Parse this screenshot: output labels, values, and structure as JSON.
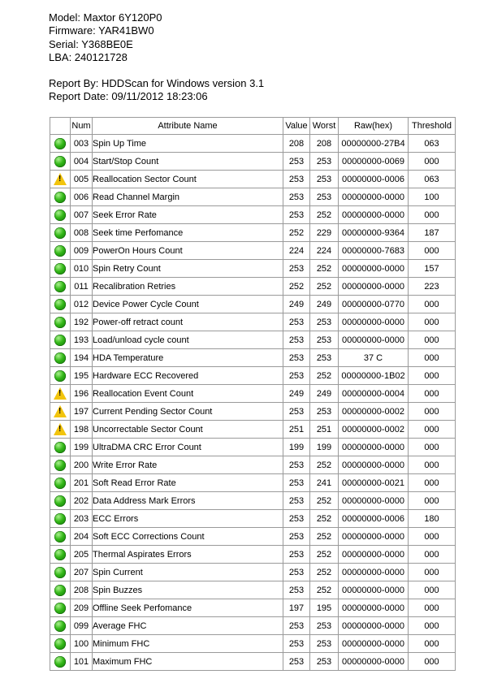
{
  "report": {
    "model": "Model: Maxtor 6Y120P0",
    "firmware": "Firmware: YAR41BW0",
    "serial": "Serial: Y368BE0E",
    "lba": "LBA: 240121728",
    "report_by": "Report By: HDDScan for Windows version 3.1",
    "report_date": "Report Date: 09/11/2012 18:23:06"
  },
  "table": {
    "headers": {
      "status": "",
      "num": "Num",
      "name": "Attribute Name",
      "value": "Value",
      "worst": "Worst",
      "raw": "Raw(hex)",
      "threshold": "Threshold"
    },
    "status_colors": {
      "ok": "#2fb514",
      "warn": "#f2c40c"
    },
    "rows": [
      {
        "status": "ok",
        "num": "003",
        "name": "Spin Up Time",
        "value": "208",
        "worst": "208",
        "raw": "00000000-27B4",
        "threshold": "063"
      },
      {
        "status": "ok",
        "num": "004",
        "name": "Start/Stop Count",
        "value": "253",
        "worst": "253",
        "raw": "00000000-0069",
        "threshold": "000"
      },
      {
        "status": "warn",
        "num": "005",
        "name": "Reallocation Sector Count",
        "value": "253",
        "worst": "253",
        "raw": "00000000-0006",
        "threshold": "063"
      },
      {
        "status": "ok",
        "num": "006",
        "name": "Read Channel Margin",
        "value": "253",
        "worst": "253",
        "raw": "00000000-0000",
        "threshold": "100"
      },
      {
        "status": "ok",
        "num": "007",
        "name": "Seek Error Rate",
        "value": "253",
        "worst": "252",
        "raw": "00000000-0000",
        "threshold": "000"
      },
      {
        "status": "ok",
        "num": "008",
        "name": "Seek time Perfomance",
        "value": "252",
        "worst": "229",
        "raw": "00000000-9364",
        "threshold": "187"
      },
      {
        "status": "ok",
        "num": "009",
        "name": "PowerOn Hours Count",
        "value": "224",
        "worst": "224",
        "raw": "00000000-7683",
        "threshold": "000"
      },
      {
        "status": "ok",
        "num": "010",
        "name": "Spin Retry Count",
        "value": "253",
        "worst": "252",
        "raw": "00000000-0000",
        "threshold": "157"
      },
      {
        "status": "ok",
        "num": "011",
        "name": "Recalibration Retries",
        "value": "252",
        "worst": "252",
        "raw": "00000000-0000",
        "threshold": "223"
      },
      {
        "status": "ok",
        "num": "012",
        "name": "Device Power Cycle Count",
        "value": "249",
        "worst": "249",
        "raw": "00000000-0770",
        "threshold": "000"
      },
      {
        "status": "ok",
        "num": "192",
        "name": "Power-off retract count",
        "value": "253",
        "worst": "253",
        "raw": "00000000-0000",
        "threshold": "000"
      },
      {
        "status": "ok",
        "num": "193",
        "name": "Load/unload cycle count",
        "value": "253",
        "worst": "253",
        "raw": "00000000-0000",
        "threshold": "000"
      },
      {
        "status": "ok",
        "num": "194",
        "name": "HDA Temperature",
        "value": "253",
        "worst": "253",
        "raw": "37 C",
        "threshold": "000"
      },
      {
        "status": "ok",
        "num": "195",
        "name": "Hardware ECC Recovered",
        "value": "253",
        "worst": "252",
        "raw": "00000000-1B02",
        "threshold": "000"
      },
      {
        "status": "warn",
        "num": "196",
        "name": "Reallocation Event Count",
        "value": "249",
        "worst": "249",
        "raw": "00000000-0004",
        "threshold": "000"
      },
      {
        "status": "warn",
        "num": "197",
        "name": "Current Pending Sector Count",
        "value": "253",
        "worst": "253",
        "raw": "00000000-0002",
        "threshold": "000"
      },
      {
        "status": "warn",
        "num": "198",
        "name": "Uncorrectable Sector Count",
        "value": "251",
        "worst": "251",
        "raw": "00000000-0002",
        "threshold": "000"
      },
      {
        "status": "ok",
        "num": "199",
        "name": "UltraDMA CRC Error Count",
        "value": "199",
        "worst": "199",
        "raw": "00000000-0000",
        "threshold": "000"
      },
      {
        "status": "ok",
        "num": "200",
        "name": "Write Error Rate",
        "value": "253",
        "worst": "252",
        "raw": "00000000-0000",
        "threshold": "000"
      },
      {
        "status": "ok",
        "num": "201",
        "name": "Soft Read Error Rate",
        "value": "253",
        "worst": "241",
        "raw": "00000000-0021",
        "threshold": "000"
      },
      {
        "status": "ok",
        "num": "202",
        "name": "Data Address Mark Errors",
        "value": "253",
        "worst": "252",
        "raw": "00000000-0000",
        "threshold": "000"
      },
      {
        "status": "ok",
        "num": "203",
        "name": "ECC Errors",
        "value": "253",
        "worst": "252",
        "raw": "00000000-0006",
        "threshold": "180"
      },
      {
        "status": "ok",
        "num": "204",
        "name": "Soft ECC Corrections Count",
        "value": "253",
        "worst": "252",
        "raw": "00000000-0000",
        "threshold": "000"
      },
      {
        "status": "ok",
        "num": "205",
        "name": "Thermal Aspirates Errors",
        "value": "253",
        "worst": "252",
        "raw": "00000000-0000",
        "threshold": "000"
      },
      {
        "status": "ok",
        "num": "207",
        "name": "Spin Current",
        "value": "253",
        "worst": "252",
        "raw": "00000000-0000",
        "threshold": "000"
      },
      {
        "status": "ok",
        "num": "208",
        "name": "Spin Buzzes",
        "value": "253",
        "worst": "252",
        "raw": "00000000-0000",
        "threshold": "000"
      },
      {
        "status": "ok",
        "num": "209",
        "name": "Offline Seek Perfomance",
        "value": "197",
        "worst": "195",
        "raw": "00000000-0000",
        "threshold": "000"
      },
      {
        "status": "ok",
        "num": "099",
        "name": "Average FHC",
        "value": "253",
        "worst": "253",
        "raw": "00000000-0000",
        "threshold": "000"
      },
      {
        "status": "ok",
        "num": "100",
        "name": "Minimum FHC",
        "value": "253",
        "worst": "253",
        "raw": "00000000-0000",
        "threshold": "000"
      },
      {
        "status": "ok",
        "num": "101",
        "name": "Maximum FHC",
        "value": "253",
        "worst": "253",
        "raw": "00000000-0000",
        "threshold": "000"
      }
    ]
  }
}
